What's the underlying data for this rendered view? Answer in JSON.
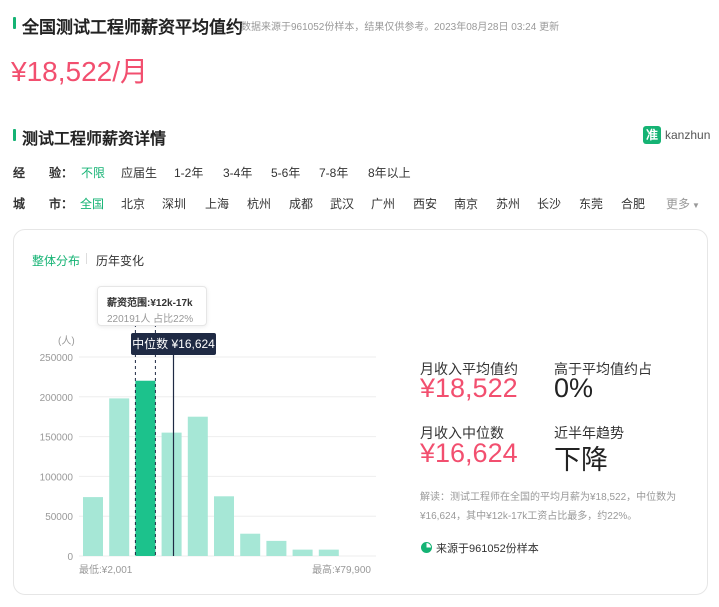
{
  "header": {
    "title": "全国测试工程师薪资平均值约",
    "source_note": "数据来源于961052份样本，结果仅供参考。",
    "updated": "2023年08月28日 03:24 更新",
    "salary": "¥18,522/月"
  },
  "detail": {
    "title": "测试工程师薪资详情",
    "logo_mark": "准",
    "logo_text": "kanzhun"
  },
  "filters": {
    "experience": {
      "label": "经　　验：",
      "options": [
        "不限",
        "应届生",
        "1-2年",
        "3-4年",
        "5-6年",
        "7-8年",
        "8年以上"
      ],
      "active": 0
    },
    "city": {
      "label": "城　　市：",
      "options": [
        "全国",
        "北京",
        "深圳",
        "上海",
        "杭州",
        "成都",
        "武汉",
        "广州",
        "西安",
        "南京",
        "苏州",
        "长沙",
        "东莞",
        "合肥"
      ],
      "active": 0,
      "more": "更多"
    }
  },
  "tabs": [
    {
      "label": "整体分布",
      "active": true
    },
    {
      "label": "历年变化",
      "active": false
    }
  ],
  "tooltip": {
    "title": "薪资范围:¥12k-17k",
    "sub": "220191人  占比22%"
  },
  "median_tag": "中位数 ¥16,624",
  "chart_data": {
    "type": "bar",
    "ylabel": "(人)",
    "yticks": [
      "250000",
      "200000",
      "150000",
      "100000",
      "50000",
      "0"
    ],
    "ylim": [
      0,
      250000
    ],
    "x_min_label": "最低:¥2,001",
    "x_max_label": "最高:¥79,900",
    "values": [
      74000,
      198000,
      155000,
      175000,
      75000,
      28000,
      19000,
      8000,
      8000
    ],
    "highlight": {
      "value": 220191,
      "label": "¥12k-17k"
    },
    "median": 16624,
    "colors": {
      "bar": "#a6e7d6",
      "highlight": "#1cc28c",
      "median_line": "#1f2a44"
    }
  },
  "stats": {
    "avg_label": "月收入平均值约",
    "avg_value": "¥18,522",
    "above_label": "高于平均值约占",
    "above_value": "0%",
    "median_label": "月收入中位数",
    "median_value": "¥16,624",
    "trend_label": "近半年趋势",
    "trend_value": "下降"
  },
  "explain": "解读：测试工程师在全国的平均月薪为¥18,522，中位数为¥16,624，其中¥12k-17k工资占比最多，约22%。",
  "source": "来源于961052份样本",
  "colors": {
    "accent": "#15b374",
    "salary_red": "#f24f6f"
  }
}
